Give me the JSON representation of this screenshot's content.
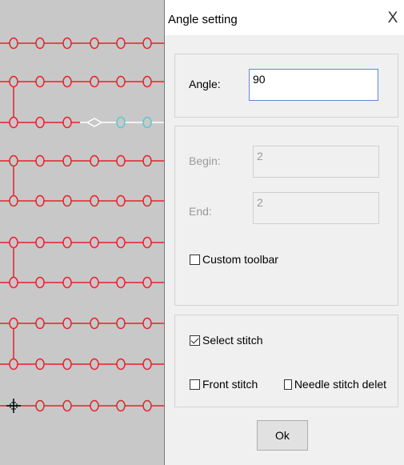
{
  "dialog": {
    "title": "Angle setting",
    "close_symbol": "X",
    "angle_label": "Angle:",
    "angle_value": "90",
    "begin_label": "Begin:",
    "begin_value": "2",
    "end_label": "End:",
    "end_value": "2",
    "custom_toolbar_label": "Custom toolbar",
    "custom_toolbar_checked": false,
    "select_stitch_label": "Select stitch",
    "select_stitch_checked": true,
    "front_stitch_label": "Front stitch",
    "front_stitch_checked": false,
    "needle_stitch_label": "Needle stitch delet",
    "needle_stitch_checked": false,
    "ok_label": "Ok"
  },
  "canvas": {
    "stitch_color": "#e8202a",
    "selected_color": "#ffffff",
    "highlight_color": "#59c9d2",
    "cursor_icon": "crosshair-move-icon"
  }
}
